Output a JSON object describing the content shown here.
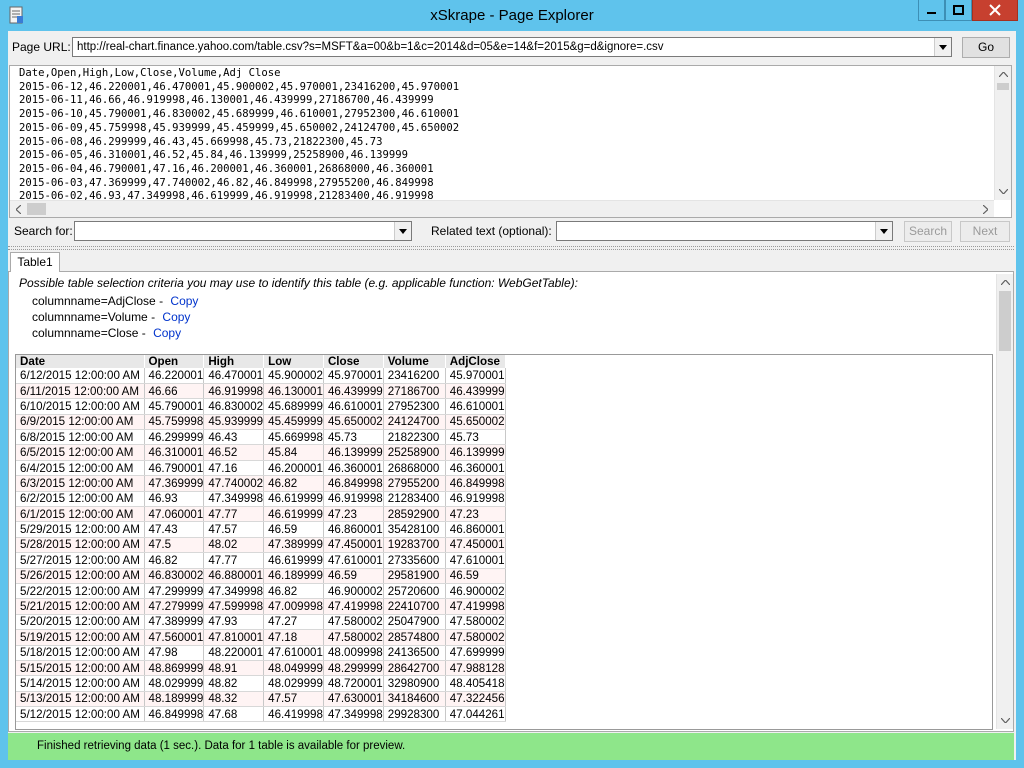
{
  "window": {
    "title": "xSkrape - Page Explorer",
    "icons": {
      "app": "app-icon",
      "minimize": "minimize-icon",
      "maximize": "maximize-icon",
      "close": "close-icon"
    }
  },
  "url_bar": {
    "label": "Page URL:",
    "value": "http://real-chart.finance.yahoo.com/table.csv?s=MSFT&a=00&b=1&c=2014&d=05&e=14&f=2015&g=d&ignore=.csv",
    "go_label": "Go"
  },
  "raw_text": "Date,Open,High,Low,Close,Volume,Adj Close\n2015-06-12,46.220001,46.470001,45.900002,45.970001,23416200,45.970001\n2015-06-11,46.66,46.919998,46.130001,46.439999,27186700,46.439999\n2015-06-10,45.790001,46.830002,45.689999,46.610001,27952300,46.610001\n2015-06-09,45.759998,45.939999,45.459999,45.650002,24124700,45.650002\n2015-06-08,46.299999,46.43,45.669998,45.73,21822300,45.73\n2015-06-05,46.310001,46.52,45.84,46.139999,25258900,46.139999\n2015-06-04,46.790001,47.16,46.200001,46.360001,26868000,46.360001\n2015-06-03,47.369999,47.740002,46.82,46.849998,27955200,46.849998\n2015-06-02,46.93,47.349998,46.619999,46.919998,21283400,46.919998",
  "search": {
    "label": "Search for:",
    "value": "",
    "related_label": "Related text (optional):",
    "related_value": "",
    "search_button": "Search",
    "next_button": "Next"
  },
  "tabs": [
    {
      "label": "Table1",
      "selected": true
    }
  ],
  "criteria": {
    "title": "Possible table selection criteria you may use to identify this table (e.g. applicable function: WebGetTable):",
    "items": [
      {
        "text": "columnname=AdjClose -",
        "link": "Copy"
      },
      {
        "text": "columnname=Volume -",
        "link": "Copy"
      },
      {
        "text": "columnname=Close -",
        "link": "Copy"
      }
    ]
  },
  "table": {
    "columns": [
      "Date",
      "Open",
      "High",
      "Low",
      "Close",
      "Volume",
      "AdjClose"
    ],
    "rows": [
      [
        "6/12/2015 12:00:00 AM",
        "46.220001",
        "46.470001",
        "45.900002",
        "45.970001",
        "23416200",
        "45.970001"
      ],
      [
        "6/11/2015 12:00:00 AM",
        "46.66",
        "46.919998",
        "46.130001",
        "46.439999",
        "27186700",
        "46.439999"
      ],
      [
        "6/10/2015 12:00:00 AM",
        "45.790001",
        "46.830002",
        "45.689999",
        "46.610001",
        "27952300",
        "46.610001"
      ],
      [
        "6/9/2015 12:00:00 AM",
        "45.759998",
        "45.939999",
        "45.459999",
        "45.650002",
        "24124700",
        "45.650002"
      ],
      [
        "6/8/2015 12:00:00 AM",
        "46.299999",
        "46.43",
        "45.669998",
        "45.73",
        "21822300",
        "45.73"
      ],
      [
        "6/5/2015 12:00:00 AM",
        "46.310001",
        "46.52",
        "45.84",
        "46.139999",
        "25258900",
        "46.139999"
      ],
      [
        "6/4/2015 12:00:00 AM",
        "46.790001",
        "47.16",
        "46.200001",
        "46.360001",
        "26868000",
        "46.360001"
      ],
      [
        "6/3/2015 12:00:00 AM",
        "47.369999",
        "47.740002",
        "46.82",
        "46.849998",
        "27955200",
        "46.849998"
      ],
      [
        "6/2/2015 12:00:00 AM",
        "46.93",
        "47.349998",
        "46.619999",
        "46.919998",
        "21283400",
        "46.919998"
      ],
      [
        "6/1/2015 12:00:00 AM",
        "47.060001",
        "47.77",
        "46.619999",
        "47.23",
        "28592900",
        "47.23"
      ],
      [
        "5/29/2015 12:00:00 AM",
        "47.43",
        "47.57",
        "46.59",
        "46.860001",
        "35428100",
        "46.860001"
      ],
      [
        "5/28/2015 12:00:00 AM",
        "47.5",
        "48.02",
        "47.389999",
        "47.450001",
        "19283700",
        "47.450001"
      ],
      [
        "5/27/2015 12:00:00 AM",
        "46.82",
        "47.77",
        "46.619999",
        "47.610001",
        "27335600",
        "47.610001"
      ],
      [
        "5/26/2015 12:00:00 AM",
        "46.830002",
        "46.880001",
        "46.189999",
        "46.59",
        "29581900",
        "46.59"
      ],
      [
        "5/22/2015 12:00:00 AM",
        "47.299999",
        "47.349998",
        "46.82",
        "46.900002",
        "25720600",
        "46.900002"
      ],
      [
        "5/21/2015 12:00:00 AM",
        "47.279999",
        "47.599998",
        "47.009998",
        "47.419998",
        "22410700",
        "47.419998"
      ],
      [
        "5/20/2015 12:00:00 AM",
        "47.389999",
        "47.93",
        "47.27",
        "47.580002",
        "25047900",
        "47.580002"
      ],
      [
        "5/19/2015 12:00:00 AM",
        "47.560001",
        "47.810001",
        "47.18",
        "47.580002",
        "28574800",
        "47.580002"
      ],
      [
        "5/18/2015 12:00:00 AM",
        "47.98",
        "48.220001",
        "47.610001",
        "48.009998",
        "24136500",
        "47.699999"
      ],
      [
        "5/15/2015 12:00:00 AM",
        "48.869999",
        "48.91",
        "48.049999",
        "48.299999",
        "28642700",
        "47.988128"
      ],
      [
        "5/14/2015 12:00:00 AM",
        "48.029999",
        "48.82",
        "48.029999",
        "48.720001",
        "32980900",
        "48.405418"
      ],
      [
        "5/13/2015 12:00:00 AM",
        "48.189999",
        "48.32",
        "47.57",
        "47.630001",
        "34184600",
        "47.322456"
      ],
      [
        "5/12/2015 12:00:00 AM",
        "46.849998",
        "47.68",
        "46.419998",
        "47.349998",
        "29928300",
        "47.044261"
      ]
    ]
  },
  "status": "Finished retrieving data (1 sec.). Data for 1 table is available for preview."
}
